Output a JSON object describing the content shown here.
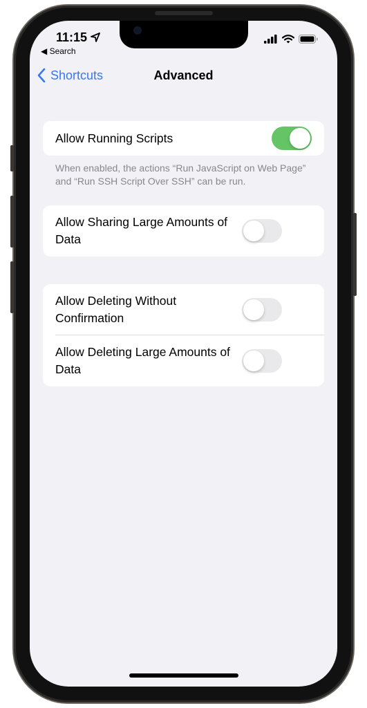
{
  "status_bar": {
    "time": "11:15",
    "back_app": "◀ Search"
  },
  "nav": {
    "back_label": "Shortcuts",
    "title": "Advanced"
  },
  "groups": [
    {
      "rows": [
        {
          "label": "Allow Running Scripts",
          "enabled": true
        }
      ],
      "footer": "When enabled, the actions “Run JavaScript on Web Page” and “Run SSH Script Over SSH” can be run."
    },
    {
      "rows": [
        {
          "label": "Allow Sharing Large Amounts of Data",
          "enabled": false
        }
      ]
    },
    {
      "rows": [
        {
          "label": "Allow Deleting Without Confirmation",
          "enabled": false
        },
        {
          "label": "Allow Deleting Large Amounts of Data",
          "enabled": false
        }
      ]
    }
  ],
  "colors": {
    "accent": "#3478f6",
    "toggle_on": "#65c466",
    "background": "#f1f1f6"
  }
}
